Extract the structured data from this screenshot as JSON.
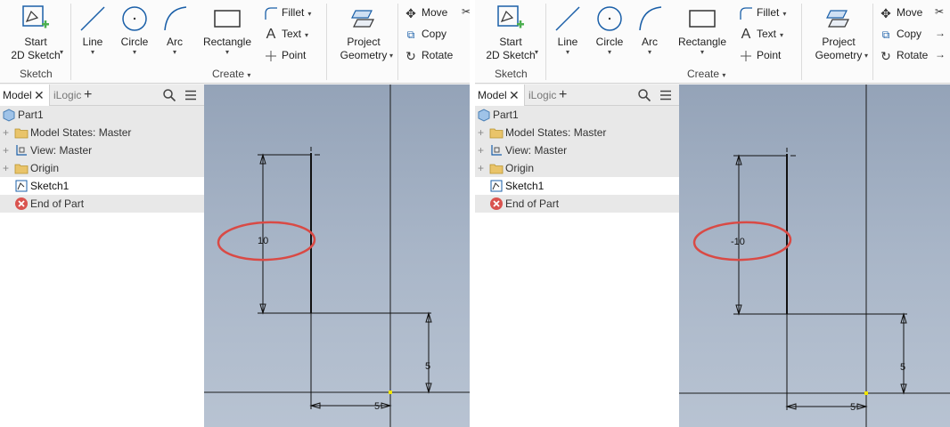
{
  "ribbon": {
    "start_sketch": "Start\n2D Sketch",
    "start_sketch_line1": "Start",
    "start_sketch_line2": "2D Sketch",
    "line": "Line",
    "circle": "Circle",
    "arc": "Arc",
    "rectangle": "Rectangle",
    "fillet": "Fillet",
    "text": "Text",
    "point": "Point",
    "project_geometry_line1": "Project",
    "project_geometry_line2": "Geometry",
    "move": "Move",
    "copy": "Copy",
    "rotate": "Rotate",
    "panel_sketch": "Sketch",
    "panel_create": "Create"
  },
  "browser": {
    "tab_model": "Model",
    "tab_ilogic": "iLogic",
    "tree": {
      "part": "Part1",
      "model_states": "Model States: Master",
      "view": "View: Master",
      "origin": "Origin",
      "sketch": "Sketch1",
      "end_of_part": "End of Part"
    }
  },
  "left_canvas": {
    "vertical_dimension": "10",
    "right_dimension": "5",
    "bottom_dimension": "5"
  },
  "right_canvas": {
    "vertical_dimension": "-10",
    "right_dimension": "5",
    "bottom_dimension": "5"
  },
  "colors": {
    "highlight_ellipse": "#d94a45",
    "icon_blue": "#1a5fa8",
    "folder_yellow": "#e9c46a",
    "error_red": "#d9534f"
  }
}
